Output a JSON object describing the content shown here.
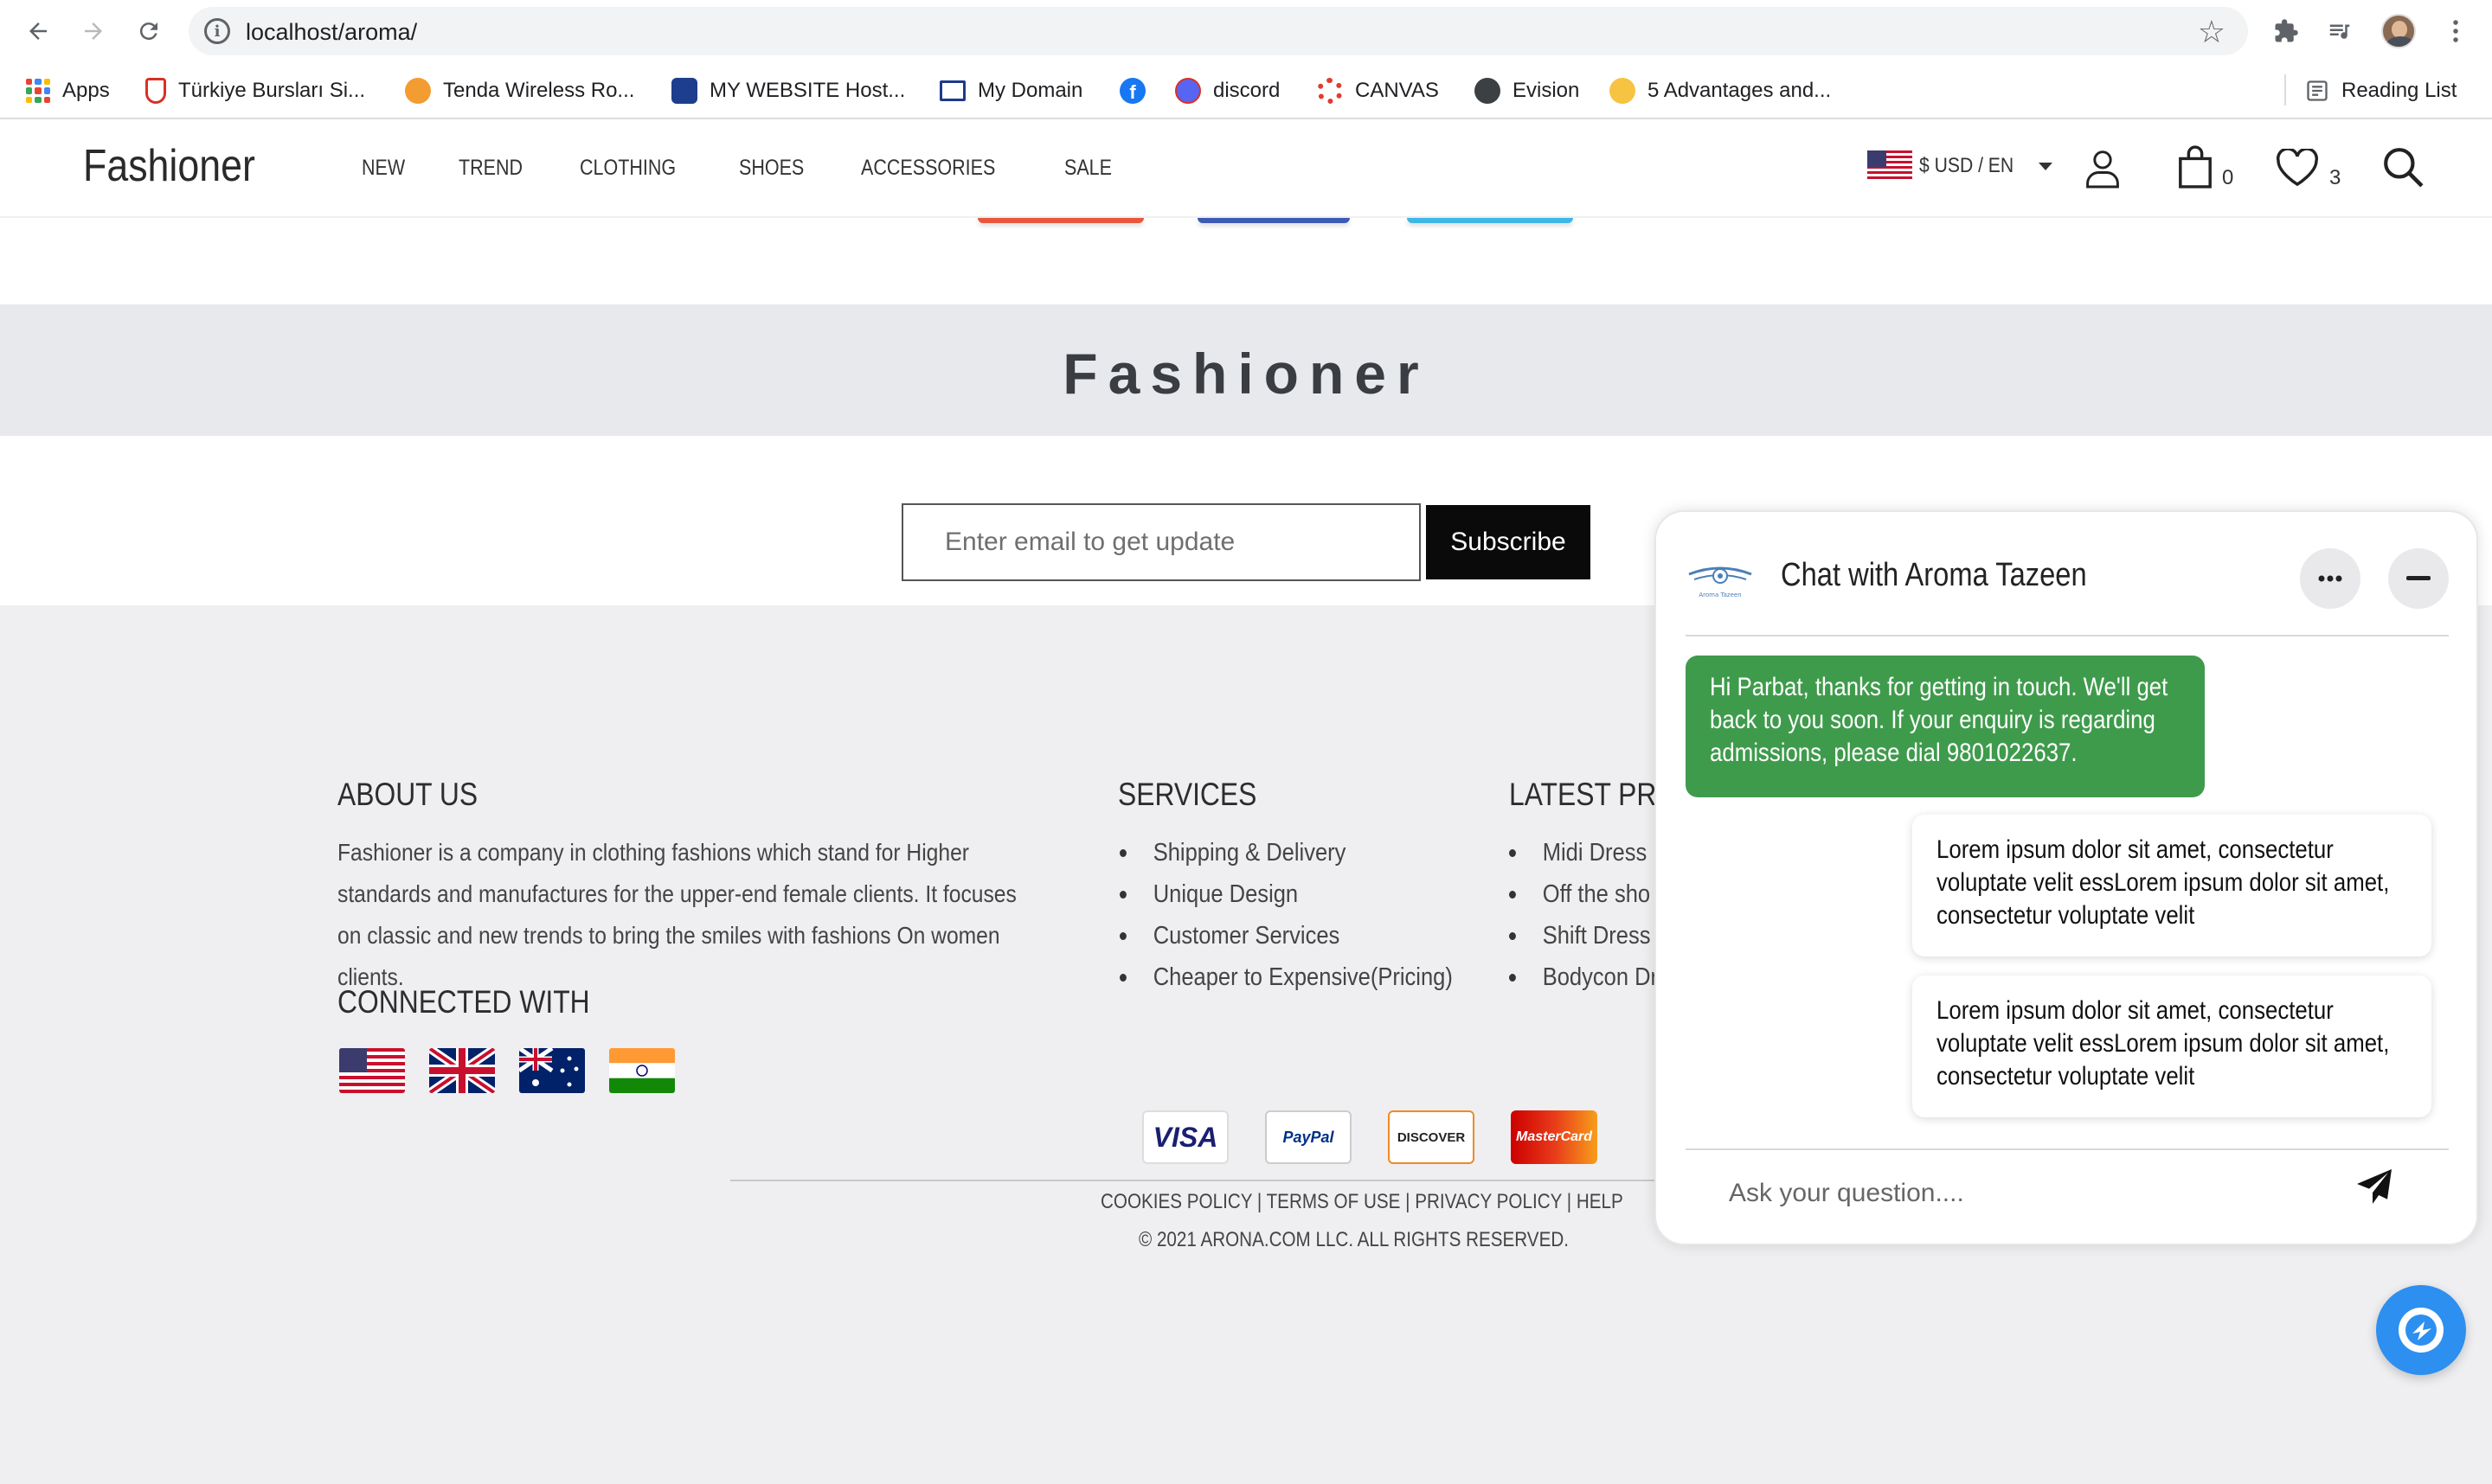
{
  "browser": {
    "url": "localhost/aroma/",
    "bookmarks": [
      {
        "label": "Apps",
        "icon": "apps-grid-icon"
      },
      {
        "label": "Türkiye Bursları Si...",
        "icon": "turkiye-burslari-icon"
      },
      {
        "label": "Tenda Wireless Ro...",
        "icon": "tenda-icon"
      },
      {
        "label": "MY WEBSITE Host...",
        "icon": "hosting-icon"
      },
      {
        "label": "My Domain",
        "icon": "domain-icon"
      },
      {
        "label": "",
        "icon": "facebook-icon"
      },
      {
        "label": "discord",
        "icon": "discord-icon"
      },
      {
        "label": "CANVAS",
        "icon": "canvas-icon"
      },
      {
        "label": "Evision",
        "icon": "evision-icon"
      },
      {
        "label": "5 Advantages and...",
        "icon": "advantages-icon"
      }
    ],
    "reading_list": "Reading List"
  },
  "header": {
    "logo": "Fashioner",
    "nav": [
      "NEW",
      "TREND",
      "CLOTHING",
      "SHOES",
      "ACCESSORIES",
      "SALE"
    ],
    "currency": "$ USD / EN",
    "cart_count": "0",
    "wishlist_count": "3"
  },
  "brand_band": {
    "title": "Fashioner"
  },
  "subscribe": {
    "placeholder": "Enter email to get update",
    "button": "Subscribe"
  },
  "footer": {
    "about_heading": "ABOUT US",
    "about_text": "Fashioner is a company in clothing fashions which stand for Higher standards and manufactures for the upper-end female clients. It focuses on classic and new trends to bring the smiles with fashions On women clients.",
    "connected_heading": "CONNECTED WITH",
    "services_heading": "SERVICES",
    "services": [
      "Shipping & Delivery",
      "Unique Design",
      "Customer Services",
      "Cheaper to Expensive(Pricing)"
    ],
    "latest_heading": "LATEST PRO",
    "latest": [
      "Midi Dress",
      "Off the sho",
      "Shift Dress",
      "Bodycon Dr"
    ],
    "payments": [
      "VISA",
      "PayPal",
      "DISCOVER",
      "MasterCard"
    ],
    "links": "COOKIES POLICY | TERMS OF USE | PRIVACY POLICY | HELP",
    "copyright": "© 2021 ARONA.COM LLC. ALL RIGHTS RESERVED."
  },
  "chat": {
    "title": "Chat with Aroma Tazeen",
    "logo_caption": "Aroma Tazeen",
    "messages": [
      {
        "from": "agent",
        "text": "Hi Parbat, thanks for getting in touch. We'll get back to you soon. If your enquiry is regarding admissions, please dial 9801022637."
      },
      {
        "from": "user",
        "text": "Lorem ipsum dolor sit amet, consectetur voluptate velit essLorem ipsum dolor sit amet, consectetur voluptate velit"
      },
      {
        "from": "user",
        "text": "Lorem ipsum dolor sit amet, consectetur voluptate velit essLorem ipsum dolor sit amet, consectetur voluptate velit"
      }
    ],
    "input_placeholder": "Ask your question...."
  },
  "colors": {
    "chat_agent_bubble": "#3f9b4c",
    "fab": "#2d8ff0",
    "subscribe_button": "#0a0a0a",
    "brand_band": "#e8e9ed"
  }
}
